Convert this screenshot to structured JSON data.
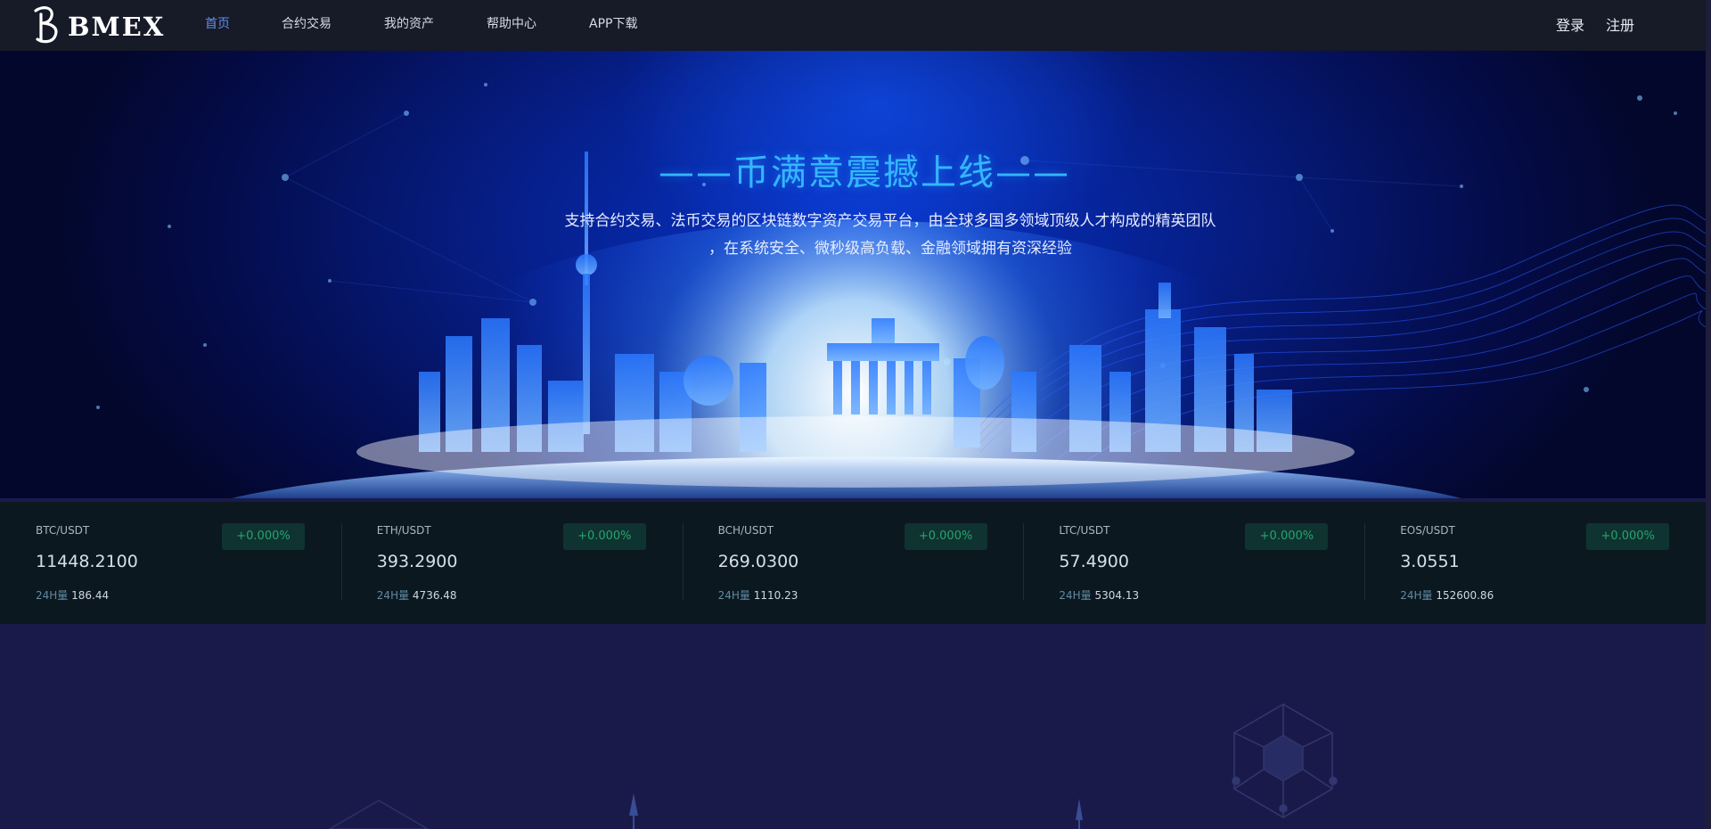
{
  "brand": {
    "name": "BMEX",
    "logo_icon": "b-logo-icon"
  },
  "nav": {
    "items": [
      {
        "label": "首页",
        "active": true
      },
      {
        "label": "合约交易",
        "active": false
      },
      {
        "label": "我的资产",
        "active": false
      },
      {
        "label": "帮助中心",
        "active": false
      },
      {
        "label": "APP下载",
        "active": false
      }
    ]
  },
  "auth": {
    "login": "登录",
    "register": "注册"
  },
  "banner": {
    "title": "——币满意震撼上线——",
    "desc_line1": "支持合约交易、法币交易的区块链数字资产交易平台，由全球多国多领域顶级人才构成的精英团队",
    "desc_line2": "，在系统安全、微秒级高负载、金融领域拥有资深经验"
  },
  "ticker": [
    {
      "pair": "BTC/USDT",
      "price": "11448.2100",
      "vol_label": "24H量",
      "vol": "186.44",
      "change": "+0.000%"
    },
    {
      "pair": "ETH/USDT",
      "price": "393.2900",
      "vol_label": "24H量",
      "vol": "4736.48",
      "change": "+0.000%"
    },
    {
      "pair": "BCH/USDT",
      "price": "269.0300",
      "vol_label": "24H量",
      "vol": "1110.23",
      "change": "+0.000%"
    },
    {
      "pair": "LTC/USDT",
      "price": "57.4900",
      "vol_label": "24H量",
      "vol": "5304.13",
      "change": "+0.000%"
    },
    {
      "pair": "EOS/USDT",
      "price": "3.0551",
      "vol_label": "24H量",
      "vol": "152600.86",
      "change": "+0.000%"
    }
  ],
  "colors": {
    "nav_active": "#5d8ff0",
    "title_accent": "#34b6ff",
    "change_up": "#27a46e",
    "change_bg": "#0f3331"
  }
}
